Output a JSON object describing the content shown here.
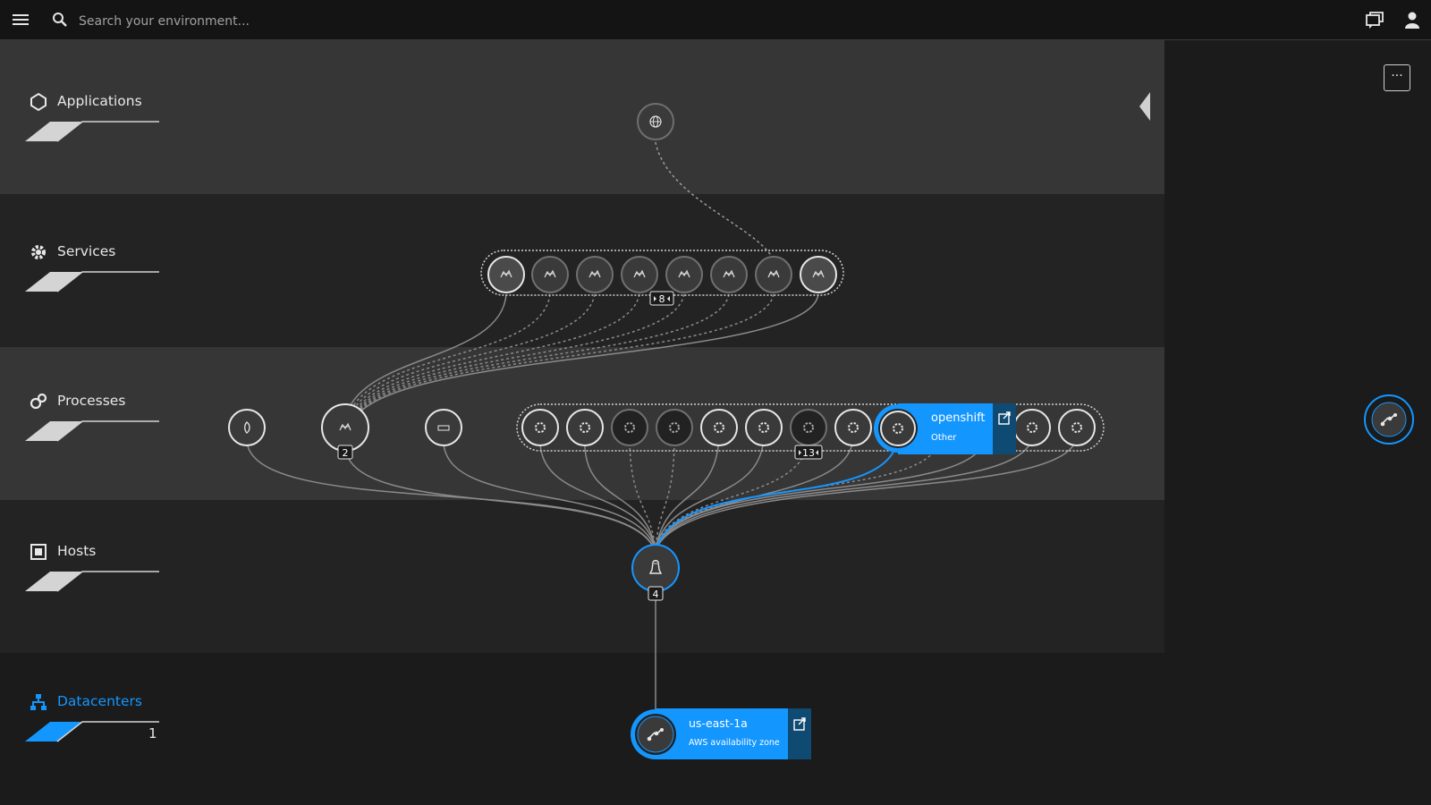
{
  "header": {
    "search_placeholder": "Search your environment..."
  },
  "layers": [
    {
      "key": "applications",
      "label": "Applications"
    },
    {
      "key": "services",
      "label": "Services"
    },
    {
      "key": "processes",
      "label": "Processes"
    },
    {
      "key": "hosts",
      "label": "Hosts"
    },
    {
      "key": "datacenters",
      "label": "Datacenters",
      "count": "1"
    }
  ],
  "services_group": {
    "badge": "8"
  },
  "processes": {
    "cluster_badge": "2",
    "group_badge": "13",
    "selected": {
      "name": "openshift",
      "type": "Other"
    }
  },
  "host": {
    "badge": "4"
  },
  "datacenter": {
    "name": "us-east-1a",
    "type": "AWS availability zone"
  },
  "colors": {
    "accent": "#1496ff",
    "band_light": "#363636",
    "band_dark": "#222222",
    "node_fill": "#3a3a3a"
  },
  "icons": [
    "menu-icon",
    "search-icon",
    "chat-icon",
    "user-icon",
    "globe-icon",
    "service-icon",
    "process-icon",
    "linux-icon",
    "datacenter-icon",
    "open-link-icon",
    "more-icon"
  ]
}
